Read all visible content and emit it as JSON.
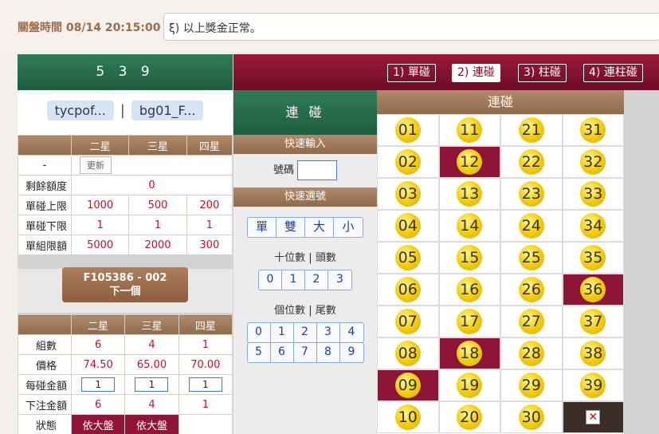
{
  "topbar": {
    "close_time": "關盤時間 08/14 20:15:00",
    "marquee": "ξ) 以上獎金正常。"
  },
  "game": {
    "title": "5 3 9"
  },
  "modes": [
    "1) 單碰",
    "2) 連碰",
    "3) 柱碰",
    "4) 連柱碰"
  ],
  "users": [
    "tycpof...",
    "bg01_F..."
  ],
  "users_sep": "|",
  "limits": {
    "headers": [
      "",
      "二星",
      "三星",
      "四星"
    ],
    "refresh_label": "更新",
    "dash": "-",
    "rows": [
      {
        "label": "剩餘額度",
        "values": [
          "0"
        ]
      },
      {
        "label": "單碰上限",
        "values": [
          "1000",
          "500",
          "200"
        ]
      },
      {
        "label": "單碰下限",
        "values": [
          "1",
          "1",
          "1"
        ]
      },
      {
        "label": "單組限額",
        "values": [
          "5000",
          "2000",
          "300"
        ]
      }
    ]
  },
  "next": {
    "line1": "F105386 - 002",
    "line2": "下一個"
  },
  "bet": {
    "headers": [
      "",
      "二星",
      "三星",
      "四星"
    ],
    "rows": [
      {
        "label": "組數",
        "values": [
          "6",
          "4",
          "1"
        ]
      },
      {
        "label": "價格",
        "values": [
          "74.50",
          "65.00",
          "70.00"
        ]
      },
      {
        "label": "每碰金額",
        "values": [
          "1",
          "1",
          "1"
        ]
      },
      {
        "label": "下注金額",
        "values": [
          "6",
          "4",
          "1"
        ]
      },
      {
        "label": "狀態",
        "values": [
          "依大盤",
          "依大盤",
          ""
        ]
      }
    ]
  },
  "quick": {
    "title": "連 碰",
    "input_title": "快速輸入",
    "haoma_label": "號碼",
    "select_title": "快速選號",
    "seg1": [
      "單",
      "雙",
      "大",
      "小"
    ],
    "tens_label": "十位數 | 頭數",
    "tens": [
      "0",
      "1",
      "2",
      "3"
    ],
    "ones_label": "個位數 | 尾數",
    "ones_row1": [
      "0",
      "1",
      "2",
      "3",
      "4"
    ],
    "ones_row2": [
      "5",
      "6",
      "7",
      "8",
      "9"
    ]
  },
  "numbers": {
    "title": "連碰",
    "grid": [
      [
        "01",
        "11",
        "21",
        "31"
      ],
      [
        "02",
        "12",
        "22",
        "32"
      ],
      [
        "03",
        "13",
        "23",
        "33"
      ],
      [
        "04",
        "14",
        "24",
        "34"
      ],
      [
        "05",
        "15",
        "25",
        "35"
      ],
      [
        "06",
        "16",
        "26",
        "36"
      ],
      [
        "07",
        "17",
        "27",
        "37"
      ],
      [
        "08",
        "18",
        "28",
        "38"
      ],
      [
        "09",
        "19",
        "29",
        "39"
      ],
      [
        "10",
        "20",
        "30",
        ""
      ]
    ],
    "selected": [
      "12",
      "36",
      "18",
      "09"
    ],
    "clear_icon": "x-icon"
  },
  "colors": {
    "green": "#2f7c57",
    "maroon": "#8e1538",
    "brown": "#9c7556"
  }
}
